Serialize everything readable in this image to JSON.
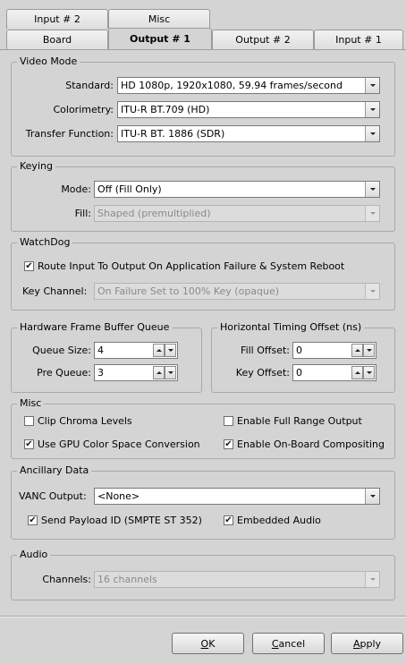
{
  "tabs": {
    "row1": [
      {
        "label": "Input # 2"
      },
      {
        "label": "Misc"
      }
    ],
    "row2": [
      {
        "label": "Board"
      },
      {
        "label": "Output # 1"
      },
      {
        "label": "Output # 2"
      },
      {
        "label": "Input # 1"
      }
    ]
  },
  "video_mode": {
    "title": "Video Mode",
    "standard_label": "Standard:",
    "standard_value": "HD 1080p, 1920x1080, 59.94 frames/second",
    "colorimetry_label": "Colorimetry:",
    "colorimetry_value": "ITU-R BT.709 (HD)",
    "transfer_label": "Transfer Function:",
    "transfer_value": "ITU-R BT. 1886 (SDR)"
  },
  "keying": {
    "title": "Keying",
    "mode_label": "Mode:",
    "mode_value": "Off (Fill Only)",
    "fill_label": "Fill:",
    "fill_value": "Shaped (premultiplied)"
  },
  "watchdog": {
    "title": "WatchDog",
    "route_label": "Route Input To Output On Application Failure & System Reboot",
    "key_channel_label": "Key Channel:",
    "key_channel_value": "On Failure Set to 100% Key (opaque)"
  },
  "frame_buffer": {
    "title": "Hardware Frame Buffer Queue",
    "queue_size_label": "Queue Size:",
    "queue_size_value": "4",
    "pre_queue_label": "Pre Queue:",
    "pre_queue_value": "3"
  },
  "timing_offset": {
    "title": "Horizontal Timing Offset (ns)",
    "fill_offset_label": "Fill Offset:",
    "fill_offset_value": "0",
    "key_offset_label": "Key Offset:",
    "key_offset_value": "0"
  },
  "misc": {
    "title": "Misc",
    "clip_chroma": "Clip Chroma Levels",
    "full_range": "Enable Full Range Output",
    "gpu_color": "Use GPU Color Space Conversion",
    "onboard": "Enable On-Board Compositing"
  },
  "ancillary": {
    "title": "Ancillary Data",
    "vanc_label": "VANC Output:",
    "vanc_value": "<None>",
    "payload_label": "Send Payload ID (SMPTE ST 352)",
    "embedded_audio": "Embedded Audio"
  },
  "audio": {
    "title": "Audio",
    "channels_label": "Channels:",
    "channels_value": "16 channels"
  },
  "buttons": {
    "ok_pre": "",
    "ok_ul": "O",
    "ok_post": "K",
    "cancel_pre": "",
    "cancel_ul": "C",
    "cancel_post": "ancel",
    "apply_pre": "",
    "apply_ul": "A",
    "apply_post": "pply"
  },
  "checks": {
    "checked_glyph": "✔"
  }
}
